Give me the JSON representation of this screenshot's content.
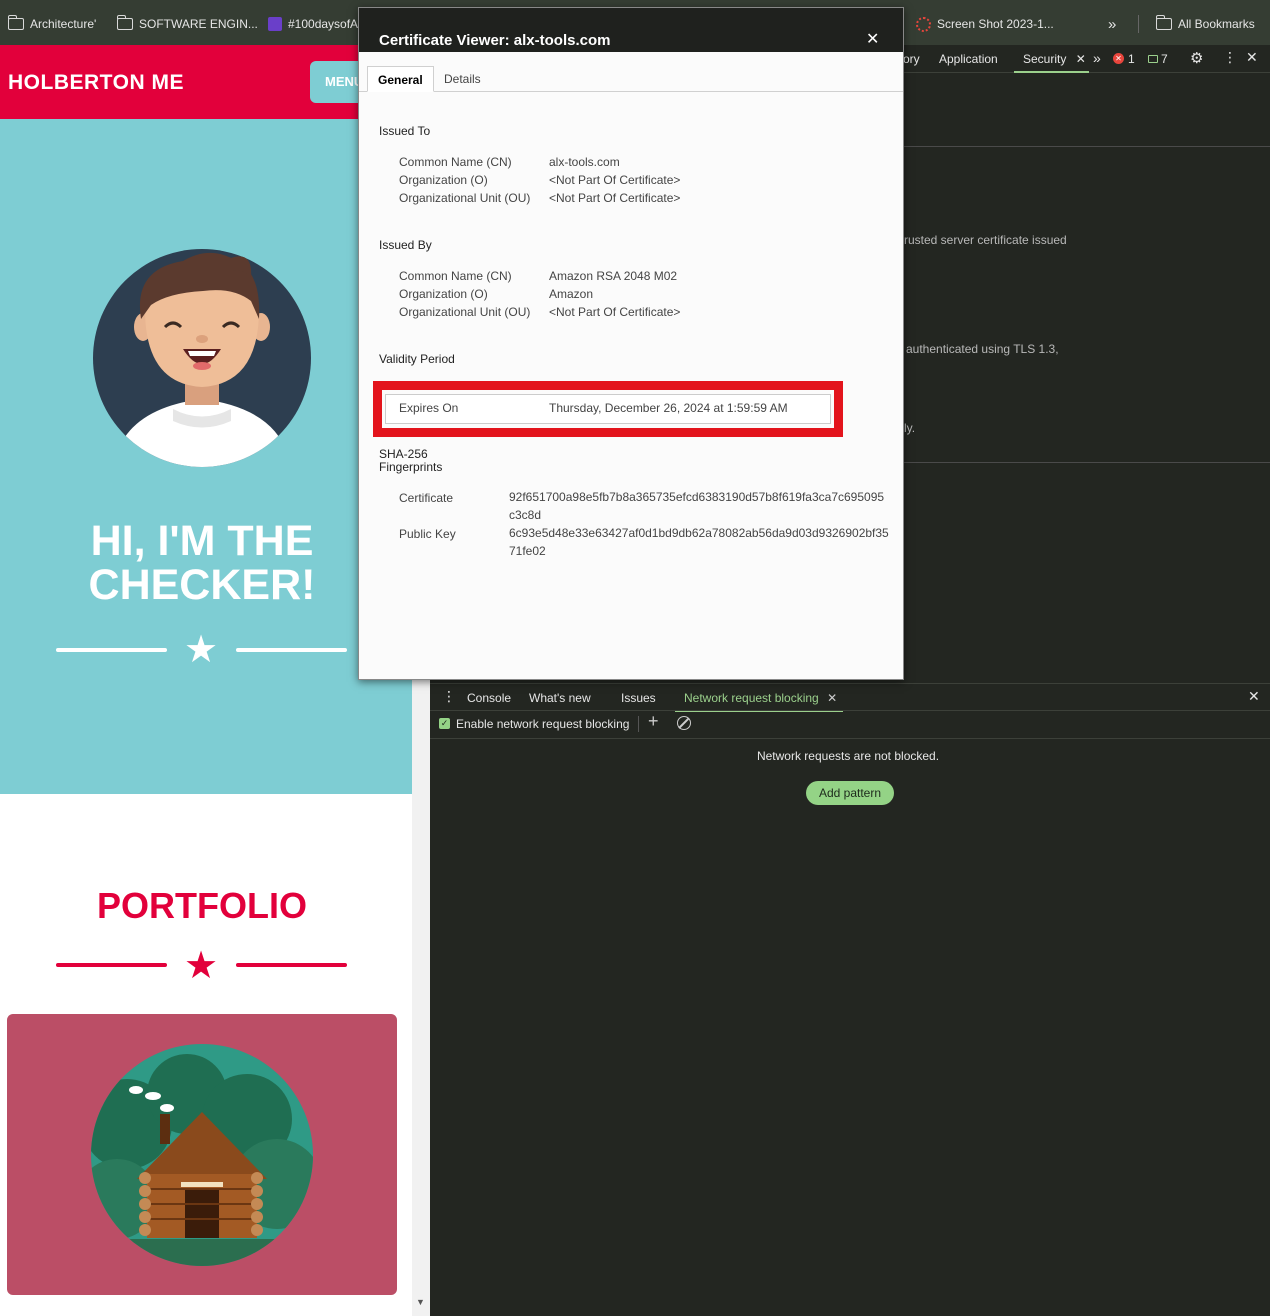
{
  "bookmarks": {
    "items": [
      {
        "label": "Architecture'",
        "icon": "folder-icon"
      },
      {
        "label": "SOFTWARE ENGIN...",
        "icon": "folder-icon"
      },
      {
        "label": "#100daysofA",
        "icon": "list-icon"
      },
      {
        "label": "Screen Shot 2023-1...",
        "icon": "screenshot-icon"
      }
    ],
    "overflow": "»",
    "all_bookmarks": "All Bookmarks"
  },
  "page": {
    "brand": "HOLBERTON ME",
    "menu_label": "MENU",
    "hero_title_line1": "HI, I'M THE",
    "hero_title_line2": "CHECKER!",
    "portfolio_title": "PORTFOLIO",
    "colors": {
      "brand_red": "#e2003b",
      "hero_teal": "#7ecdd3",
      "card_pink": "#bb4e66"
    }
  },
  "devtools": {
    "tabs": {
      "partial": "ory",
      "application": "Application",
      "security": "Security",
      "more": "»",
      "errors": "1",
      "messages": "7"
    },
    "security_lines": [
      "rusted server certificate issued",
      "authenticated using TLS 1.3,",
      "ly."
    ],
    "drawer": {
      "tabs": [
        "Console",
        "What's new",
        "Issues",
        "Network request blocking"
      ],
      "enable_label": "Enable network request blocking",
      "empty_message": "Network requests are not blocked.",
      "add_pattern": "Add pattern"
    }
  },
  "certificate": {
    "title": "Certificate Viewer: alx-tools.com",
    "tabs": {
      "general": "General",
      "details": "Details"
    },
    "issued_to": {
      "heading": "Issued To",
      "cn_label": "Common Name (CN)",
      "cn": "alx-tools.com",
      "o_label": "Organization (O)",
      "o": "<Not Part Of Certificate>",
      "ou_label": "Organizational Unit (OU)",
      "ou": "<Not Part Of Certificate>"
    },
    "issued_by": {
      "heading": "Issued By",
      "cn_label": "Common Name (CN)",
      "cn": "Amazon RSA 2048 M02",
      "o_label": "Organization (O)",
      "o": "Amazon",
      "ou_label": "Organizational Unit (OU)",
      "ou": "<Not Part Of Certificate>"
    },
    "validity": {
      "heading": "Validity Period",
      "expires_label": "Expires On",
      "expires": "Thursday, December 26, 2024 at 1:59:59 AM"
    },
    "fingerprints": {
      "heading_line1": "SHA-256",
      "heading_line2": "Fingerprints",
      "certificate_label": "Certificate",
      "certificate": "92f651700a98e5fb7b8a365735efcd6383190d57b8f619fa3ca7c695095c3c8d",
      "public_key_label": "Public Key",
      "public_key": "6c93e5d48e33e63427af0d1bd9db62a78082ab56da9d03d9326902bf3571fe02"
    }
  }
}
